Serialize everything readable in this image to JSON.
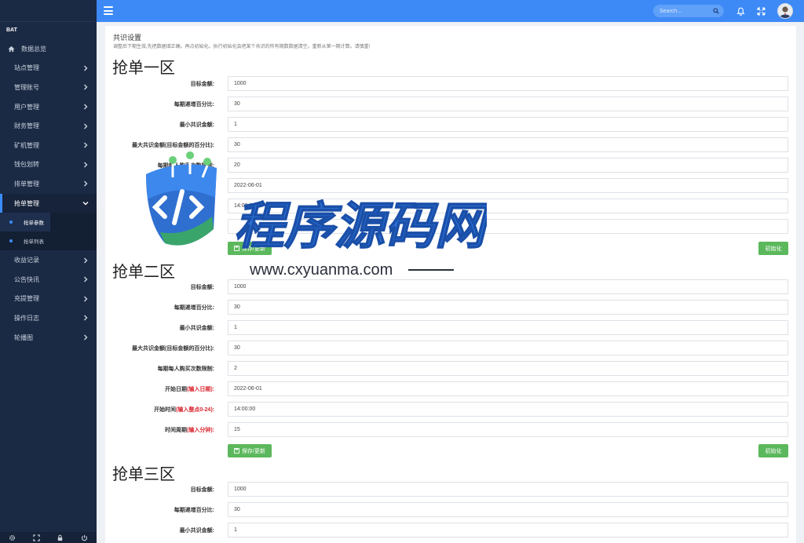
{
  "sidebar": {
    "user_label": "BAT",
    "items": [
      {
        "label": "数据总览"
      },
      {
        "label": "站点管理"
      },
      {
        "label": "管理账号"
      },
      {
        "label": "用户管理"
      },
      {
        "label": "财务管理"
      },
      {
        "label": "矿机管理"
      },
      {
        "label": "钱包划转"
      },
      {
        "label": "排单管理"
      },
      {
        "label": "抢单管理"
      },
      {
        "label": "收益记录"
      },
      {
        "label": "公告快讯"
      },
      {
        "label": "充提管理"
      },
      {
        "label": "操作日志"
      },
      {
        "label": "轮播图"
      }
    ],
    "subitems": [
      {
        "label": "抢单参数"
      },
      {
        "label": "抢单列表"
      }
    ]
  },
  "topbar": {
    "search_placeholder": "Search..."
  },
  "page": {
    "title": "共识设置",
    "description": "调整后下期生效,先把数据填正确。再点初始化。执行初始化会把某个共识的所有期数数据清空。重新从第一期计算。请慎重!",
    "save_label": "保存/更新",
    "init_label": "初始化"
  },
  "zones": [
    {
      "title": "抢单一区",
      "fields": [
        {
          "label": "目标金额:",
          "hint": "",
          "value": "1000"
        },
        {
          "label": "每期递增百分比:",
          "hint": "",
          "value": "30"
        },
        {
          "label": "最小共识金额:",
          "hint": "",
          "value": "1"
        },
        {
          "label": "最大共识金额(目标金额的百分比):",
          "hint": "",
          "value": "30"
        },
        {
          "label": "每期每人购买次数限制:",
          "hint": "",
          "value": "20"
        },
        {
          "label": "开始日期",
          "hint": "(输入日期):",
          "value": "2022-06-01"
        },
        {
          "label": "开始时间",
          "hint": "(输入整点0-24):",
          "value": "14:00:00"
        },
        {
          "label": "时间周期",
          "hint": "(输入分钟):",
          "value": ""
        }
      ]
    },
    {
      "title": "抢单二区",
      "fields": [
        {
          "label": "目标金额:",
          "hint": "",
          "value": "1000"
        },
        {
          "label": "每期递增百分比:",
          "hint": "",
          "value": "30"
        },
        {
          "label": "最小共识金额:",
          "hint": "",
          "value": "1"
        },
        {
          "label": "最大共识金额(目标金额的百分比):",
          "hint": "",
          "value": "30"
        },
        {
          "label": "每期每人购买次数限制:",
          "hint": "",
          "value": "2"
        },
        {
          "label": "开始日期",
          "hint": "(输入日期):",
          "value": "2022-06-01"
        },
        {
          "label": "开始时间",
          "hint": "(输入整点0-24):",
          "value": "14:00:00"
        },
        {
          "label": "时间周期",
          "hint": "(输入分钟):",
          "value": "15"
        }
      ]
    },
    {
      "title": "抢单三区",
      "fields": [
        {
          "label": "目标金额:",
          "hint": "",
          "value": "1000"
        },
        {
          "label": "每期递增百分比:",
          "hint": "",
          "value": "30"
        },
        {
          "label": "最小共识金额:",
          "hint": "",
          "value": "1"
        }
      ]
    }
  ],
  "watermark": {
    "brand": "程序源码网",
    "url": "www.cxyuanma.com"
  },
  "colors": {
    "sidebar_bg": "#1b2a44",
    "topbar_bg": "#3d8af7",
    "button_green": "#5cb85c",
    "hint_red": "#d9232d"
  }
}
